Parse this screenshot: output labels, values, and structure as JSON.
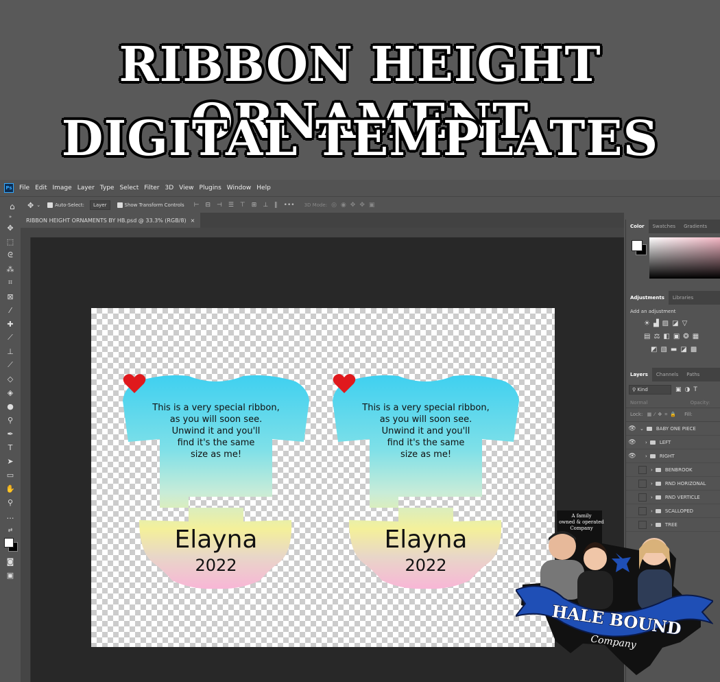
{
  "banner": {
    "line1": "RIBBON HEIGHT ORNAMENT",
    "line2": "DIGITAL TEMPLATES"
  },
  "menu": {
    "logo": "Ps",
    "items": [
      "File",
      "Edit",
      "Image",
      "Layer",
      "Type",
      "Select",
      "Filter",
      "3D",
      "View",
      "Plugins",
      "Window",
      "Help"
    ]
  },
  "options": {
    "auto_select_label": "Auto-Select:",
    "auto_select_value": "Layer",
    "transform_label": "Show Transform Controls",
    "mode_3d": "3D Mode:"
  },
  "document": {
    "tab_title": "RIBBON HEIGHT ORNAMENTS BY HB.psd @ 33.3% (RGB/8)",
    "close": "×"
  },
  "ornaments": [
    {
      "poem": [
        "This is a very special ribbon,",
        "as you will soon see.",
        "Unwind it and you'll",
        "find it's the same",
        "size as me!"
      ],
      "name": "Elayna",
      "year": "2022"
    },
    {
      "poem": [
        "This is a very special ribbon,",
        "as you will soon see.",
        "Unwind it and you'll",
        "find it's the same",
        "size as me!"
      ],
      "name": "Elayna",
      "year": "2022"
    }
  ],
  "panels": {
    "color_tabs": [
      "Color",
      "Swatches",
      "Gradients"
    ],
    "adjust_tabs": [
      "Adjustments",
      "Libraries"
    ],
    "add_adjustment": "Add an adjustment",
    "layer_tabs": [
      "Layers",
      "Channels",
      "Paths"
    ],
    "kind_label": "Kind",
    "blend_mode": "Normal",
    "opacity_label": "Opacity:",
    "lock_label": "Lock:",
    "fill_label": "Fill:"
  },
  "layers": [
    {
      "name": "BABY ONE PIECE",
      "visible": true,
      "indent": 0,
      "open": true
    },
    {
      "name": "LEFT",
      "visible": true,
      "indent": 1,
      "open": false
    },
    {
      "name": "RIGHT",
      "visible": true,
      "indent": 1,
      "open": false
    },
    {
      "name": "BENBROOK",
      "visible": false,
      "indent": 0,
      "open": false
    },
    {
      "name": "RND HORIZONAL",
      "visible": false,
      "indent": 0,
      "open": false
    },
    {
      "name": "RND VERTICLE",
      "visible": false,
      "indent": 0,
      "open": false
    },
    {
      "name": "SCALLOPED",
      "visible": false,
      "indent": 0,
      "open": false
    },
    {
      "name": "TREE",
      "visible": false,
      "indent": 0,
      "open": false
    }
  ],
  "logo": {
    "tagline": [
      "A family",
      "owned & operated",
      "Company"
    ],
    "brand": "HALE BOUND",
    "sub": "Company"
  },
  "colors": {
    "accent_red": "#e0191d",
    "brand_blue": "#1f4fb6"
  }
}
